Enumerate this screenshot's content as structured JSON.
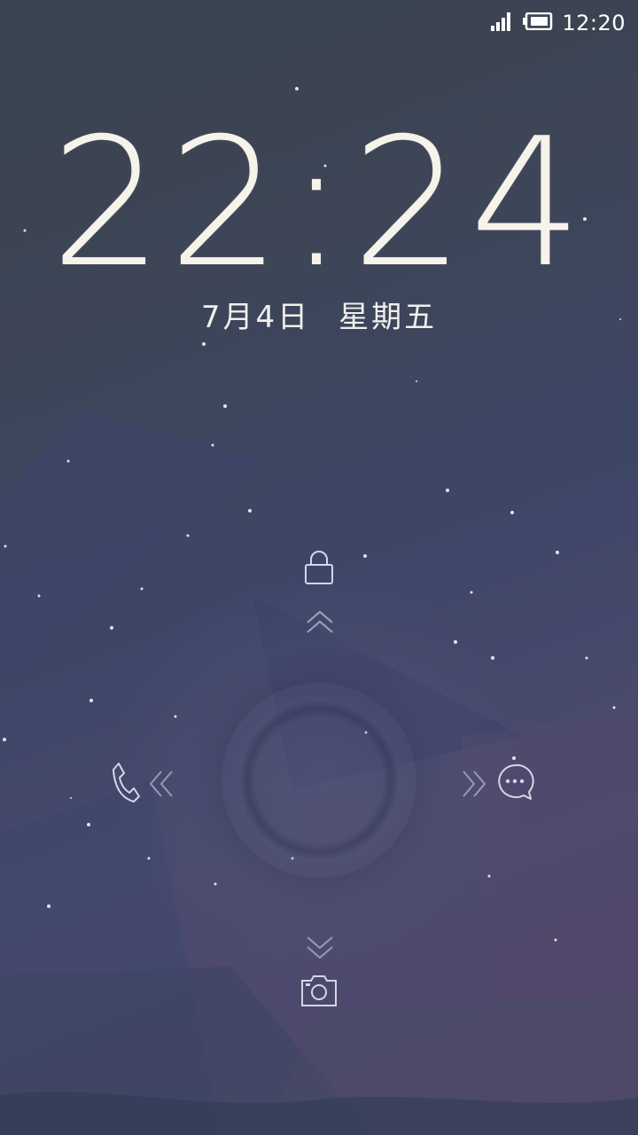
{
  "status_bar": {
    "time": "12:20",
    "icons": [
      "signal-icon",
      "battery-icon"
    ]
  },
  "clock": {
    "time": "22:24",
    "date_day": "7月4日",
    "date_weekday": "星期五"
  },
  "controls": {
    "up": {
      "icon": "lock-icon",
      "hint": "chevron-up-double-icon"
    },
    "down": {
      "icon": "camera-icon",
      "hint": "chevron-down-icon"
    },
    "left": {
      "icon": "phone-icon",
      "hint": "chevron-left-double-icon"
    },
    "right": {
      "icon": "message-icon",
      "hint": "chevron-right-double-icon"
    }
  },
  "colors": {
    "text": "#f6f4ea",
    "icon": "#c9cbe0"
  }
}
